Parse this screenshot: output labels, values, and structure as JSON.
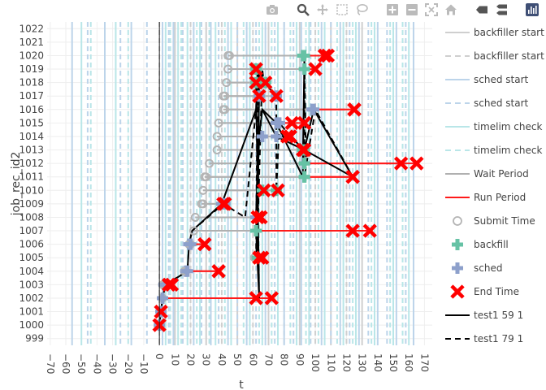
{
  "toolbar": {
    "buttons": [
      "camera-icon",
      "zoom-icon",
      "pan-icon",
      "box-select-icon",
      "lasso-icon",
      "zoom-in-icon",
      "zoom-out-icon",
      "autoscale-icon",
      "home-icon",
      "spike-lines-icon",
      "compare-hover-icon",
      "plotly-logo-icon"
    ]
  },
  "colors": {
    "backfiller": "#cfcfcf",
    "sched": "#bcd4ea",
    "timelim": "#b9e6e8",
    "wait": "#b0b0b0",
    "run": "#ff1a1a",
    "submit": "#b4b4b4",
    "backfill": "#66c2a5",
    "sched_marker": "#8da0cb",
    "end": "#ff0000",
    "trace": "#000000"
  },
  "chart_data": {
    "type": "scatter",
    "xlabel": "t",
    "ylabel": "job_rec_id2",
    "xlim": [
      -72,
      175
    ],
    "ylim": [
      998.5,
      1022.5
    ],
    "xticks": [
      -70,
      -60,
      -50,
      -40,
      -30,
      -20,
      -10,
      0,
      10,
      20,
      30,
      40,
      50,
      60,
      70,
      80,
      90,
      100,
      110,
      120,
      130,
      140,
      150,
      160,
      170
    ],
    "yticks": [
      999,
      1000,
      1001,
      1002,
      1003,
      1004,
      1005,
      1006,
      1007,
      1008,
      1009,
      1010,
      1011,
      1012,
      1013,
      1014,
      1015,
      1016,
      1017,
      1018,
      1019,
      1020,
      1021,
      1022
    ],
    "grid": true,
    "legend_position": "right",
    "legend": [
      {
        "label": "backfiller start",
        "kind": "vline",
        "dash": "solid",
        "color": "#cfcfcf"
      },
      {
        "label": "backfiller start",
        "kind": "vline",
        "dash": "dash",
        "color": "#cfcfcf"
      },
      {
        "label": "sched start",
        "kind": "vline",
        "dash": "solid",
        "color": "#bcd4ea"
      },
      {
        "label": "sched start",
        "kind": "vline",
        "dash": "dash",
        "color": "#bcd4ea"
      },
      {
        "label": "timelim check",
        "kind": "vline",
        "dash": "solid",
        "color": "#b9e6e8"
      },
      {
        "label": "timelim check",
        "kind": "vline",
        "dash": "dash",
        "color": "#b9e6e8"
      },
      {
        "label": "Wait Period",
        "kind": "line",
        "dash": "solid",
        "color": "#b0b0b0"
      },
      {
        "label": "Run Period",
        "kind": "line",
        "dash": "solid",
        "color": "#ff1a1a"
      },
      {
        "label": "Submit Time",
        "kind": "circle",
        "color": "#b4b4b4"
      },
      {
        "label": "backfill",
        "kind": "plus",
        "color": "#66c2a5"
      },
      {
        "label": "sched",
        "kind": "plus",
        "color": "#8da0cb"
      },
      {
        "label": "End Time",
        "kind": "x",
        "color": "#ff0000"
      },
      {
        "label": "test1 59 1",
        "kind": "line",
        "dash": "solid",
        "color": "#000000"
      },
      {
        "label": "test1 79 1",
        "kind": "line",
        "dash": "dash",
        "color": "#000000"
      }
    ],
    "vlines": {
      "backfiller_solid": [
        10,
        30,
        50,
        70,
        90,
        110,
        130
      ],
      "backfiller_dash": [
        0,
        20,
        40,
        60,
        80,
        100,
        120
      ],
      "sched_solid": [
        -56,
        -35,
        -18,
        2,
        9,
        22,
        33,
        44,
        56,
        68,
        80,
        91,
        104,
        116,
        128,
        140,
        152,
        163
      ],
      "sched_dash": [
        -46,
        -25,
        -8,
        6,
        15,
        27,
        38,
        50,
        62,
        74,
        86,
        97,
        110,
        122,
        134,
        146,
        158
      ],
      "timelim_solid": [
        -50,
        -28,
        4,
        12,
        18,
        26,
        36,
        46,
        58,
        66,
        76,
        88,
        96,
        106,
        118,
        126,
        138,
        150,
        160
      ],
      "timelim_dash": [
        -44,
        -20,
        7,
        14,
        24,
        32,
        42,
        54,
        64,
        72,
        84,
        94,
        102,
        114,
        124,
        136,
        148,
        156
      ]
    },
    "jobs": [
      {
        "id": 1000,
        "submit": 0,
        "start": 0,
        "end": 0,
        "kind": "sched"
      },
      {
        "id": 1001,
        "submit": 1,
        "start": 1,
        "end": 1,
        "kind": "sched"
      },
      {
        "id": 1002,
        "submit": 2,
        "start": 2,
        "end": 62,
        "kind": "sched"
      },
      {
        "id": 1002,
        "submit": 2,
        "start": 2,
        "end": 72,
        "kind": "sched"
      },
      {
        "id": 1003,
        "submit": 2,
        "start": 3,
        "end": 8,
        "kind": "sched"
      },
      {
        "id": 1003,
        "submit": 3,
        "start": 4,
        "end": 6,
        "kind": "sched"
      },
      {
        "id": 1004,
        "submit": 16,
        "start": 17,
        "end": 38,
        "kind": "sched"
      },
      {
        "id": 1004,
        "submit": 17,
        "start": 18,
        "end": 38,
        "kind": "sched"
      },
      {
        "id": 1005,
        "submit": 61,
        "start": 62,
        "end": 64,
        "kind": "backfill"
      },
      {
        "id": 1005,
        "submit": 61,
        "start": 63,
        "end": 66,
        "kind": "backfill"
      },
      {
        "id": 1006,
        "submit": 19,
        "start": 19,
        "end": 29,
        "kind": "sched"
      },
      {
        "id": 1006,
        "submit": 20,
        "start": 20,
        "end": 29,
        "kind": "sched"
      },
      {
        "id": 1007,
        "submit": 22,
        "start": 62,
        "end": 124,
        "kind": "backfill"
      },
      {
        "id": 1007,
        "submit": 22,
        "start": 62,
        "end": 135,
        "kind": "backfill"
      },
      {
        "id": 1008,
        "submit": 23,
        "start": 62,
        "end": 63,
        "kind": "sched"
      },
      {
        "id": 1008,
        "submit": 23,
        "start": 62,
        "end": 65,
        "kind": "sched"
      },
      {
        "id": 1009,
        "submit": 27,
        "start": 40,
        "end": 41,
        "kind": "sched"
      },
      {
        "id": 1009,
        "submit": 28,
        "start": 42,
        "end": 42,
        "kind": "sched"
      },
      {
        "id": 1010,
        "submit": 28,
        "start": 66,
        "end": 67,
        "kind": "backfill"
      },
      {
        "id": 1010,
        "submit": 28,
        "start": 75,
        "end": 76,
        "kind": "backfill"
      },
      {
        "id": 1011,
        "submit": 29,
        "start": 93,
        "end": 124,
        "kind": "backfill"
      },
      {
        "id": 1011,
        "submit": 30,
        "start": 93,
        "end": 124,
        "kind": "backfill"
      },
      {
        "id": 1012,
        "submit": 32,
        "start": 93,
        "end": 155,
        "kind": "backfill"
      },
      {
        "id": 1012,
        "submit": 32,
        "start": 93,
        "end": 165,
        "kind": "backfill"
      },
      {
        "id": 1013,
        "submit": 37,
        "start": 92,
        "end": 92,
        "kind": "backfill"
      },
      {
        "id": 1013,
        "submit": 37,
        "start": 93,
        "end": 93,
        "kind": "backfill"
      },
      {
        "id": 1014,
        "submit": 37,
        "start": 66,
        "end": 82,
        "kind": "sched"
      },
      {
        "id": 1014,
        "submit": 37,
        "start": 75,
        "end": 84,
        "kind": "sched"
      },
      {
        "id": 1015,
        "submit": 38,
        "start": 75,
        "end": 85,
        "kind": "sched"
      },
      {
        "id": 1015,
        "submit": 38,
        "start": 77,
        "end": 93,
        "kind": "sched"
      },
      {
        "id": 1016,
        "submit": 41,
        "start": 98,
        "end": 125,
        "kind": "sched"
      },
      {
        "id": 1016,
        "submit": 42,
        "start": 99,
        "end": 125,
        "kind": "sched"
      },
      {
        "id": 1017,
        "submit": 41,
        "start": 64,
        "end": 64,
        "kind": "sched"
      },
      {
        "id": 1017,
        "submit": 42,
        "start": 75,
        "end": 75,
        "kind": "sched"
      },
      {
        "id": 1018,
        "submit": 43,
        "start": 62,
        "end": 62,
        "kind": "backfill"
      },
      {
        "id": 1018,
        "submit": 43,
        "start": 68,
        "end": 68,
        "kind": "backfill"
      },
      {
        "id": 1019,
        "submit": 44,
        "start": 62,
        "end": 62,
        "kind": "backfill"
      },
      {
        "id": 1019,
        "submit": 44,
        "start": 93,
        "end": 100,
        "kind": "backfill"
      },
      {
        "id": 1020,
        "submit": 44,
        "start": 92,
        "end": 106,
        "kind": "backfill"
      },
      {
        "id": 1020,
        "submit": 45,
        "start": 93,
        "end": 108,
        "kind": "backfill"
      }
    ],
    "series": [
      {
        "name": "test1 59 1",
        "dash": "solid",
        "x": [
          0,
          1,
          2,
          4,
          18,
          19,
          21,
          40,
          62,
          64,
          62,
          63,
          64,
          62,
          64,
          62,
          64,
          66,
          75,
          92,
          93,
          92,
          93,
          99,
          124,
          124,
          93,
          75,
          66
        ],
        "y": [
          1000,
          1001,
          1002,
          1003,
          1004,
          1006,
          1007,
          1009,
          1016,
          1017,
          1008,
          1005,
          1019,
          1018,
          1002,
          1007,
          1014,
          1016,
          1015,
          1011,
          1020,
          1012,
          1013,
          1016,
          1011,
          1011,
          1013,
          1014,
          1016
        ]
      },
      {
        "name": "test1 79 1",
        "dash": "dash",
        "x": [
          0,
          1,
          2,
          4,
          18,
          19,
          21,
          41,
          55,
          62,
          63,
          62,
          63,
          66,
          67,
          75,
          75,
          77,
          84,
          93,
          93,
          94,
          93,
          100,
          124,
          124
        ],
        "y": [
          1000,
          1001,
          1002,
          1003,
          1004,
          1006,
          1007,
          1009,
          1008,
          1016,
          1019,
          1005,
          1007,
          1019,
          1018,
          1017,
          1010,
          1015,
          1014,
          1013,
          1020,
          1012,
          1011,
          1016,
          1011,
          1011
        ]
      }
    ]
  }
}
